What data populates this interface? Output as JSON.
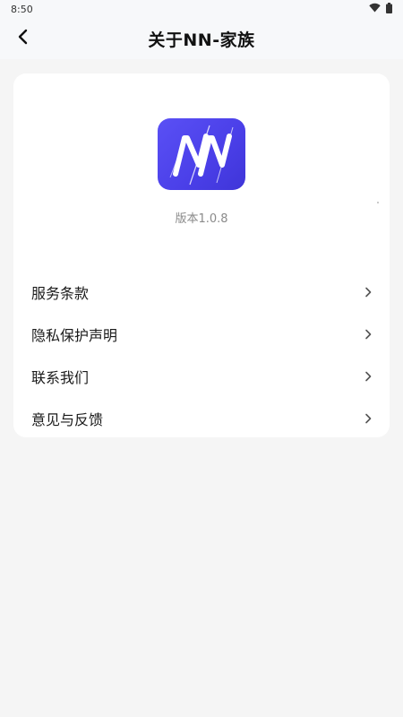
{
  "status_bar": {
    "time": "8:50"
  },
  "nav": {
    "title": "关于NN-家族"
  },
  "app": {
    "version": "版本1.0.8"
  },
  "menu": {
    "items": [
      {
        "label": "服务条款"
      },
      {
        "label": "隐私保护声明"
      },
      {
        "label": "联系我们"
      },
      {
        "label": "意见与反馈"
      }
    ]
  },
  "colors": {
    "logo_bg": "#4f46ef",
    "page_bg": "#f5f5f5",
    "card_bg": "#ffffff"
  }
}
